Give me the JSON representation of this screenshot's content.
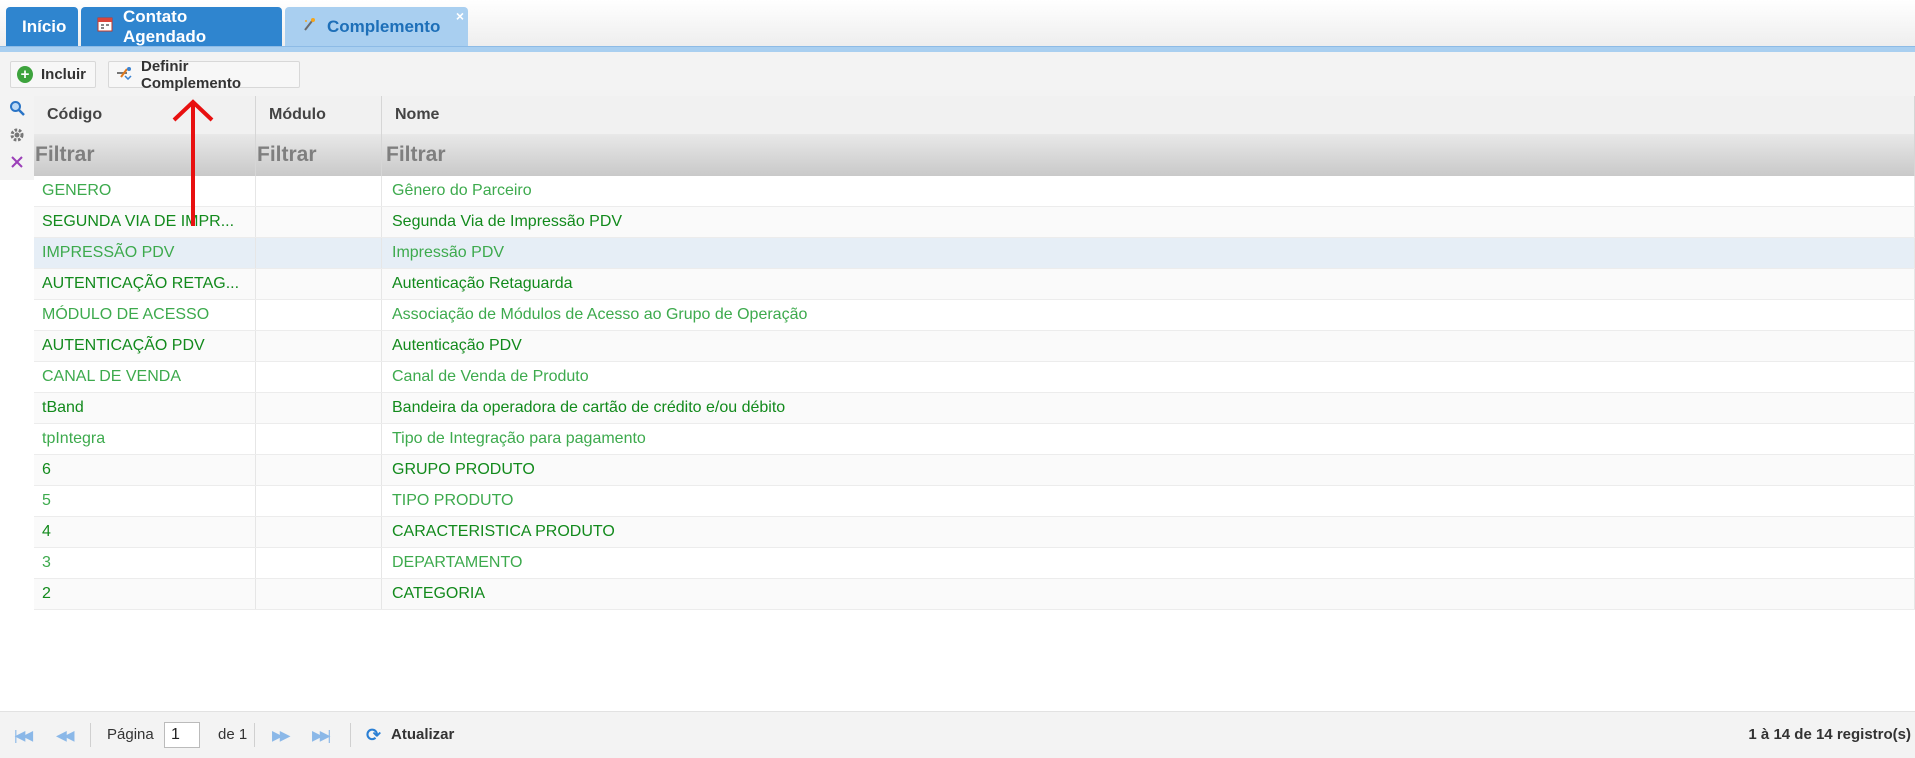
{
  "tabs": [
    {
      "label": "Início",
      "icon": ""
    },
    {
      "label": "Contato Agendado",
      "icon": "calendar-icon"
    },
    {
      "label": "Complemento",
      "icon": "wand-icon",
      "close": "×"
    }
  ],
  "toolbar": {
    "include_label": "Incluir",
    "define_label": "Definir Complemento"
  },
  "grid": {
    "columns": [
      "Código",
      "Módulo",
      "Nome"
    ],
    "filter_placeholder": "Filtrar",
    "rows": [
      {
        "codigo": "GENERO",
        "modulo": "",
        "nome": "Gênero do Parceiro"
      },
      {
        "codigo": "SEGUNDA VIA DE IMPR...",
        "modulo": "",
        "nome": "Segunda Via de Impressão PDV"
      },
      {
        "codigo": "IMPRESSÃO PDV",
        "modulo": "",
        "nome": "Impressão PDV"
      },
      {
        "codigo": "AUTENTICAÇÃO RETAG...",
        "modulo": "",
        "nome": "Autenticação Retaguarda"
      },
      {
        "codigo": "MÓDULO DE ACESSO",
        "modulo": "",
        "nome": "Associação de Módulos de Acesso ao Grupo de Operação"
      },
      {
        "codigo": "AUTENTICAÇÃO PDV",
        "modulo": "",
        "nome": "Autenticação PDV"
      },
      {
        "codigo": "CANAL DE VENDA",
        "modulo": "",
        "nome": "Canal de Venda de Produto"
      },
      {
        "codigo": "tBand",
        "modulo": "",
        "nome": "Bandeira da operadora de cartão de crédito e/ou débito"
      },
      {
        "codigo": "tpIntegra",
        "modulo": "",
        "nome": "Tipo de Integração para pagamento"
      },
      {
        "codigo": "6",
        "modulo": "",
        "nome": "GRUPO PRODUTO"
      },
      {
        "codigo": "5",
        "modulo": "",
        "nome": "TIPO PRODUTO"
      },
      {
        "codigo": "4",
        "modulo": "",
        "nome": "CARACTERISTICA PRODUTO"
      },
      {
        "codigo": "3",
        "modulo": "",
        "nome": "DEPARTAMENTO"
      },
      {
        "codigo": "2",
        "modulo": "",
        "nome": "CATEGORIA"
      }
    ]
  },
  "footer": {
    "page_label": "Página",
    "page_value": "1",
    "of_label": "de 1",
    "refresh_label": "Atualizar",
    "records": "1 à 14 de 14 registro(s)"
  },
  "colors": {
    "tab_blue": "#2f85cf",
    "tab_active": "#a9cff0",
    "text_green_light": "#3daa4d",
    "text_green_dark": "#128a1c",
    "selected_row": "#e6eef6",
    "annotation_red": "#e81010"
  }
}
